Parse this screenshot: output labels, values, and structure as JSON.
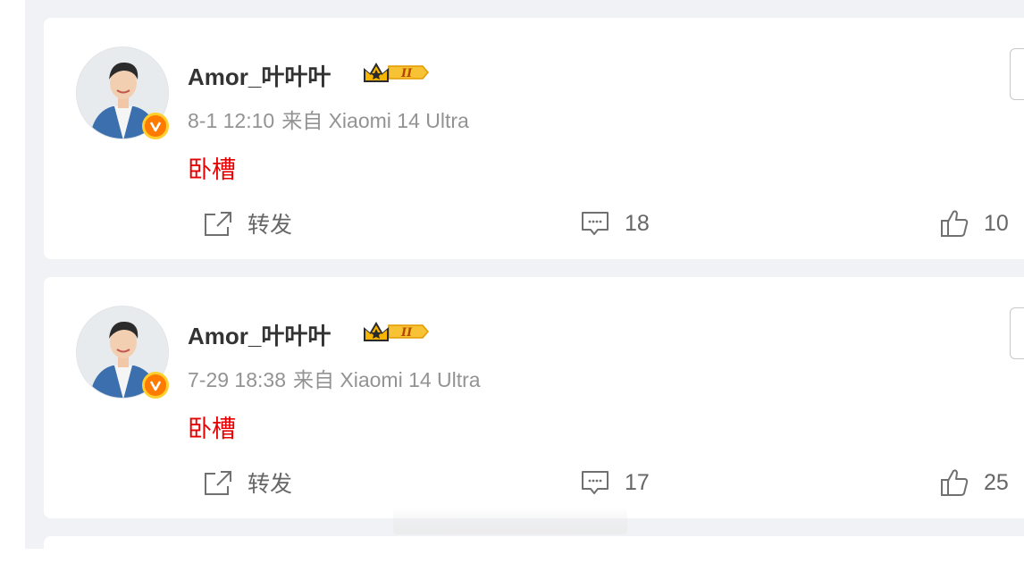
{
  "posts": [
    {
      "username": "Amor_叶叶叶",
      "time": "8-1 12:10",
      "source": "来自 Xiaomi 14 Ultra",
      "content": "卧槽",
      "share_label": "转发",
      "comments": "18",
      "likes": "10"
    },
    {
      "username": "Amor_叶叶叶",
      "time": "7-29 18:38",
      "source": "来自 Xiaomi 14 Ultra",
      "content": "卧槽",
      "share_label": "转发",
      "comments": "17",
      "likes": "25"
    }
  ],
  "badge": {
    "level": "II"
  },
  "colors": {
    "content_red": "#e60000",
    "verified_orange": "#ff7a00",
    "verified_ring": "#ffcf2e",
    "crown_gold": "#f7b500",
    "feed_bg": "#f1f2f5"
  },
  "icons": [
    "verified-v-icon",
    "crown-vip-icon",
    "share-icon",
    "comment-icon",
    "like-icon"
  ]
}
